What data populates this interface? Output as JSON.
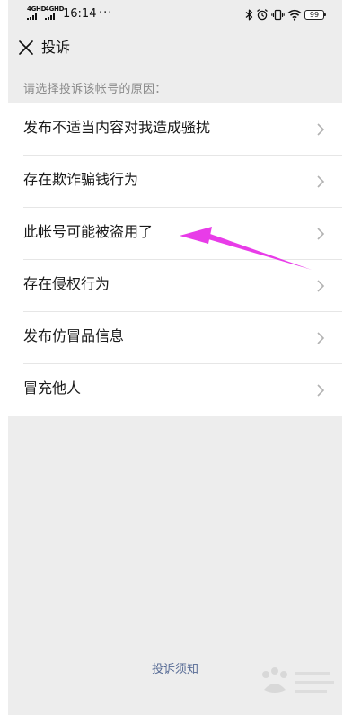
{
  "status_bar": {
    "sim1_tag": "4GHD",
    "sim2_tag": "4GHD",
    "time": "16:14",
    "more": "···",
    "battery": "99",
    "icons": [
      "bluetooth-icon",
      "alarm-icon",
      "vibrate-icon",
      "wifi-icon",
      "battery-icon"
    ]
  },
  "nav": {
    "close_icon": "close-icon",
    "title": "投诉"
  },
  "hint": "请选择投诉该帐号的原因：",
  "reasons": [
    {
      "label": "发布不适当内容对我造成骚扰"
    },
    {
      "label": "存在欺诈骗钱行为"
    },
    {
      "label": "此帐号可能被盗用了"
    },
    {
      "label": "存在侵权行为"
    },
    {
      "label": "发布仿冒品信息"
    },
    {
      "label": "冒充他人"
    }
  ],
  "footer_link": "投诉须知",
  "colors": {
    "page_bg": "#ededed",
    "link": "#576b95",
    "annotation_arrow": "#e83ce8"
  }
}
